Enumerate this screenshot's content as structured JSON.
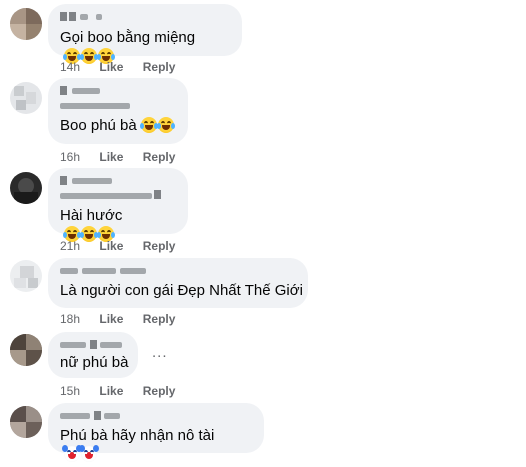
{
  "comments": [
    {
      "text": "Gọi boo bằng miệng",
      "emoji": [
        "laughing-crying-face",
        "laughing-crying-face",
        "laughing-crying-face"
      ],
      "time": "14h",
      "like": "Like",
      "reply": "Reply"
    },
    {
      "text": "Boo phú bà",
      "emoji": [
        "laughing-crying-face",
        "laughing-crying-face"
      ],
      "time": "16h",
      "like": "Like",
      "reply": "Reply"
    },
    {
      "text": "Hài hước",
      "emoji": [
        "laughing-crying-face",
        "laughing-crying-face",
        "laughing-crying-face"
      ],
      "time": "21h",
      "like": "Like",
      "reply": "Reply"
    },
    {
      "text": "Là người con gái Đẹp Nhất Thế Giới",
      "emoji": [],
      "time": "18h",
      "like": "Like",
      "reply": "Reply"
    },
    {
      "text": "nữ phú bà",
      "emoji": [],
      "time": "15h",
      "like": "Like",
      "reply": "Reply",
      "more": "..."
    },
    {
      "text": "Phú bà hãy nhận nô tài",
      "emoji": [
        "clown-face",
        "clown-face"
      ],
      "time": "",
      "like": "",
      "reply": ""
    }
  ],
  "colors": {
    "bubble": "#f0f2f5",
    "meta_text": "#65676b",
    "text": "#050505"
  }
}
